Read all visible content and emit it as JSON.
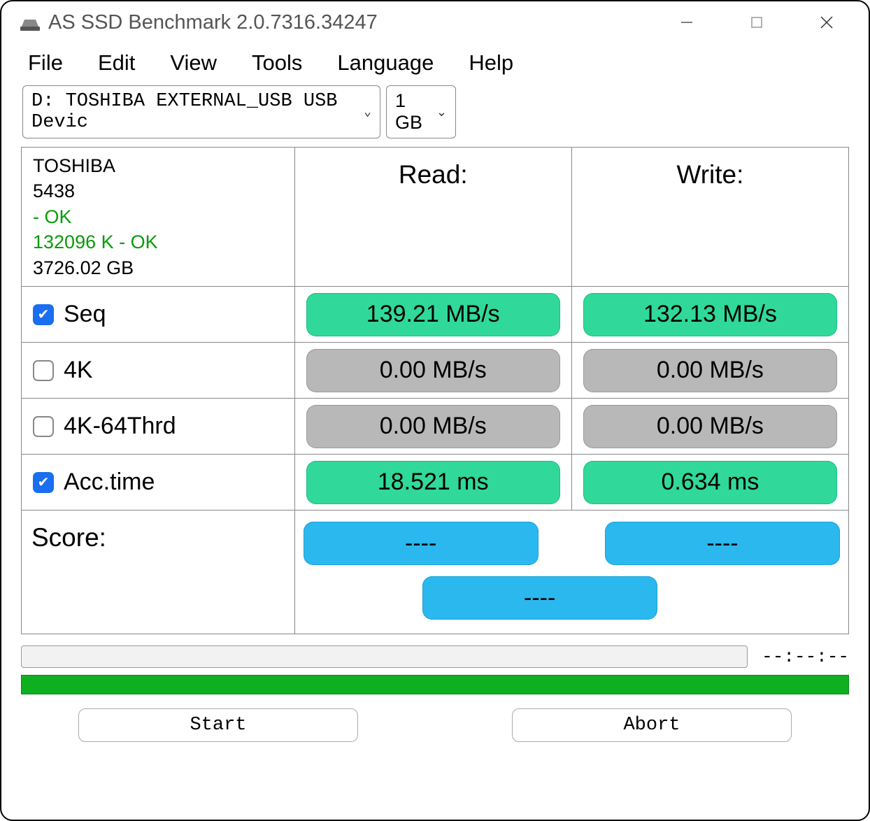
{
  "window": {
    "title": "AS SSD Benchmark 2.0.7316.34247"
  },
  "menu": {
    "file": "File",
    "edit": "Edit",
    "view": "View",
    "tools": "Tools",
    "language": "Language",
    "help": "Help"
  },
  "selectors": {
    "drive": "D: TOSHIBA EXTERNAL_USB USB Devic",
    "size": "1 GB"
  },
  "device_info": {
    "name": "TOSHIBA",
    "id": "5438",
    "status1": " - OK",
    "status2": "132096 K - OK",
    "capacity": "3726.02 GB"
  },
  "headers": {
    "read": "Read:",
    "write": "Write:"
  },
  "rows": {
    "seq": {
      "label": "Seq",
      "checked": true,
      "read": "139.21 MB/s",
      "write": "132.13 MB/s",
      "color": "green"
    },
    "k4": {
      "label": "4K",
      "checked": false,
      "read": "0.00 MB/s",
      "write": "0.00 MB/s",
      "color": "gray"
    },
    "k4thrd": {
      "label": "4K-64Thrd",
      "checked": false,
      "read": "0.00 MB/s",
      "write": "0.00 MB/s",
      "color": "gray"
    },
    "acc": {
      "label": "Acc.time",
      "checked": true,
      "read": "18.521 ms",
      "write": "0.634 ms",
      "color": "green"
    }
  },
  "score": {
    "label": "Score:",
    "read": "----",
    "write": "----",
    "total": "----"
  },
  "footer": {
    "timer": "--:--:--",
    "start": "Start",
    "abort": "Abort"
  }
}
